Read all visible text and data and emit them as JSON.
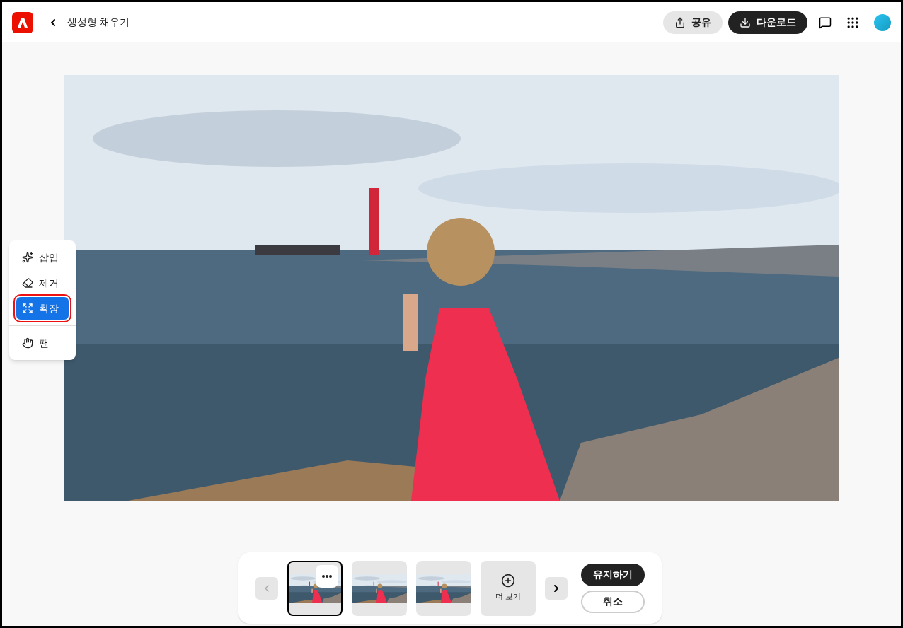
{
  "header": {
    "title": "생성형 채우기",
    "share": "공유",
    "download": "다운로드"
  },
  "tools": [
    {
      "kind": "insert",
      "label": "삽입",
      "selected": false,
      "highlighted": false
    },
    {
      "kind": "remove",
      "label": "제거",
      "selected": false,
      "highlighted": false
    },
    {
      "kind": "expand",
      "label": "확장",
      "selected": true,
      "highlighted": true
    },
    {
      "kind": "pan",
      "label": "팬",
      "selected": false,
      "highlighted": false
    }
  ],
  "variations": [
    {
      "selected": true
    },
    {
      "selected": false
    },
    {
      "selected": false
    }
  ],
  "more": "더 보기",
  "keep": "유지하기",
  "cancel": "취소"
}
